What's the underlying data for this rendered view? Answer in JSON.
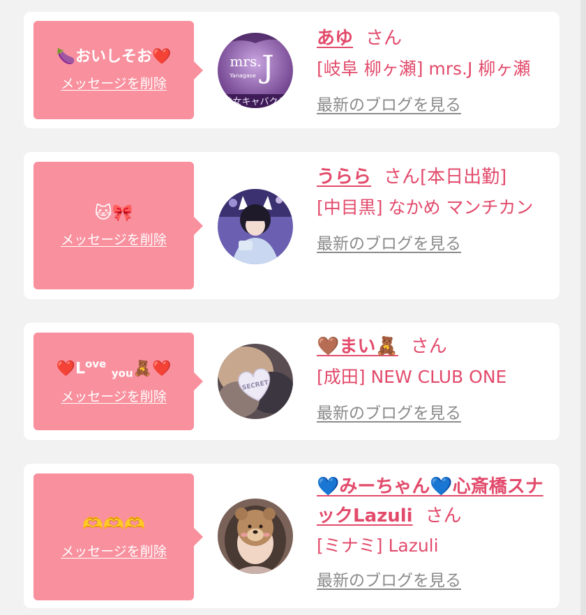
{
  "messages": [
    {
      "bubble_text": "🍆おいしそお❤️",
      "delete_label": "メッセージを削除",
      "cast_name": "あゆ",
      "honorific": "さん",
      "shop": "[岐阜 柳ヶ瀬] mrs.J 柳ヶ瀬",
      "blog_link": "最新のブログを見る",
      "avatar_text": {
        "brand": "mrs.",
        "letter": "J",
        "sub": "Yanagase",
        "bottom": "熟女キャバクラ"
      }
    },
    {
      "bubble_text": "🐱🎀",
      "delete_label": "メッセージを削除",
      "cast_name": "うらら",
      "honorific": "さん[本日出勤]",
      "shop": "[中目黒] なかめ マンチカン",
      "blog_link": "最新のブログを見る"
    },
    {
      "bubble_parts": {
        "heart_left": "❤️",
        "love": "L",
        "love_sup": "ove",
        "you_sub": "you",
        "tail": "🧸❤️"
      },
      "delete_label": "メッセージを削除",
      "cast_name": "🤎まい🧸",
      "honorific": "さん",
      "shop": "[成田] NEW CLUB ONE",
      "blog_link": "最新のブログを見る",
      "avatar_text": {
        "badge": "SECRET"
      }
    },
    {
      "bubble_text": "🫶🫶🫶",
      "delete_label": "メッセージを削除",
      "cast_name": "💙みーちゃん💙心斎橋スナックLazuli",
      "honorific": "さん",
      "shop": "[ミナミ] Lazuli",
      "blog_link": "最新のブログを見る"
    }
  ]
}
